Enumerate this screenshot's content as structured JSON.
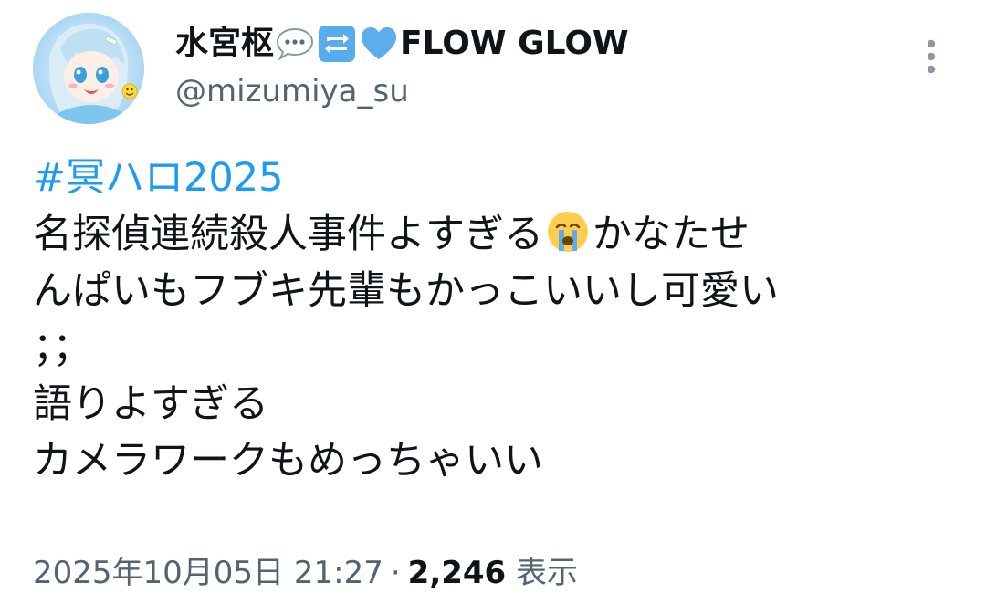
{
  "author": {
    "display_name_text": "水宮枢",
    "display_name_emojis": [
      "speech-bubble-icon",
      "repeat-icon",
      "blue-heart-icon"
    ],
    "display_name_suffix": "FLOW GLOW",
    "handle": "@mizumiya_su"
  },
  "tweet": {
    "hashtag": "#冥ハロ2025",
    "line1_text": "名探偵連続殺人事件よすぎる",
    "line1_emoji": "crying-face-icon",
    "line1_suffix": "かなたせ",
    "line2": "んぱいもフブキ先輩もかっこいいし可愛い",
    "line3": "；；",
    "line4": "語りよすぎる",
    "line5": "カメラワークもめっちゃいい"
  },
  "meta": {
    "timestamp": "2025年10月05日 21:27",
    "separator": "·",
    "views_count": "2,246",
    "views_label": "表示"
  },
  "colors": {
    "link": "#1d9bf0",
    "secondary": "#536471",
    "primary_text": "#0f1419"
  }
}
